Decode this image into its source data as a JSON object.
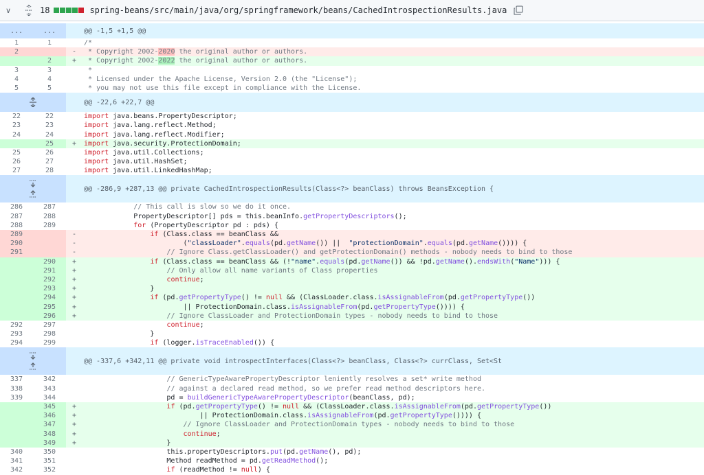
{
  "header": {
    "changes_count": "18",
    "file_path": "spring-beans/src/main/java/org/springframework/beans/CachedIntrospectionResults.java",
    "diffstat": [
      "#2da44e",
      "#2da44e",
      "#2da44e",
      "#2da44e",
      "#cf222e"
    ]
  },
  "hunks": [
    {
      "header": "@@ -1,5 +1,5 @@",
      "expander": "dots"
    },
    {
      "header": "@@ -22,6 +22,7 @@",
      "expander": "both"
    },
    {
      "header": "@@ -286,9 +287,13 @@ private CachedIntrospectionResults(Class<?> beanClass) throws BeansException {",
      "expander": "updown"
    },
    {
      "header": "@@ -337,6 +342,11 @@ private void introspectInterfaces(Class<?> beanClass, Class<?> currClass, Set<St",
      "expander": "updown"
    }
  ],
  "hunk1_left_dots": "...",
  "hunk1_right_dots": "...",
  "lines": {
    "h1": [
      {
        "o": "1",
        "n": "1",
        "t": "ctx",
        "c": "/*"
      },
      {
        "o": "2",
        "n": "",
        "t": "del",
        "c": " * Copyright 2002-2020 the original author or authors."
      },
      {
        "o": "",
        "n": "2",
        "t": "add",
        "c": " * Copyright 2002-2022 the original author or authors."
      },
      {
        "o": "3",
        "n": "3",
        "t": "ctx",
        "c": " *"
      },
      {
        "o": "4",
        "n": "4",
        "t": "ctx",
        "c": " * Licensed under the Apache License, Version 2.0 (the \"License\");"
      },
      {
        "o": "5",
        "n": "5",
        "t": "ctx",
        "c": " * you may not use this file except in compliance with the License."
      }
    ],
    "h2": [
      {
        "o": "22",
        "n": "22",
        "t": "ctx",
        "c": "import java.beans.PropertyDescriptor;"
      },
      {
        "o": "23",
        "n": "23",
        "t": "ctx",
        "c": "import java.lang.reflect.Method;"
      },
      {
        "o": "24",
        "n": "24",
        "t": "ctx",
        "c": "import java.lang.reflect.Modifier;"
      },
      {
        "o": "",
        "n": "25",
        "t": "add",
        "c": "import java.security.ProtectionDomain;"
      },
      {
        "o": "25",
        "n": "26",
        "t": "ctx",
        "c": "import java.util.Collections;"
      },
      {
        "o": "26",
        "n": "27",
        "t": "ctx",
        "c": "import java.util.HashSet;"
      },
      {
        "o": "27",
        "n": "28",
        "t": "ctx",
        "c": "import java.util.LinkedHashMap;"
      }
    ],
    "h3": [
      {
        "o": "286",
        "n": "287",
        "t": "ctx",
        "c": "            // This call is slow so we do it once."
      },
      {
        "o": "287",
        "n": "288",
        "t": "ctx",
        "c": "            PropertyDescriptor[] pds = this.beanInfo.getPropertyDescriptors();"
      },
      {
        "o": "288",
        "n": "289",
        "t": "ctx",
        "c": "            for (PropertyDescriptor pd : pds) {"
      },
      {
        "o": "289",
        "n": "",
        "t": "del",
        "c": "                if (Class.class == beanClass &&"
      },
      {
        "o": "290",
        "n": "",
        "t": "del",
        "c": "                        (\"classLoader\".equals(pd.getName()) ||  \"protectionDomain\".equals(pd.getName()))) {"
      },
      {
        "o": "291",
        "n": "",
        "t": "del",
        "c": "                    // Ignore Class.getClassLoader() and getProtectionDomain() methods - nobody needs to bind to those"
      },
      {
        "o": "",
        "n": "290",
        "t": "add",
        "c": "                if (Class.class == beanClass && (!\"name\".equals(pd.getName()) && !pd.getName().endsWith(\"Name\"))) {"
      },
      {
        "o": "",
        "n": "291",
        "t": "add",
        "c": "                    // Only allow all name variants of Class properties"
      },
      {
        "o": "",
        "n": "292",
        "t": "add",
        "c": "                    continue;"
      },
      {
        "o": "",
        "n": "293",
        "t": "add",
        "c": "                }"
      },
      {
        "o": "",
        "n": "294",
        "t": "add",
        "c": "                if (pd.getPropertyType() != null && (ClassLoader.class.isAssignableFrom(pd.getPropertyType())"
      },
      {
        "o": "",
        "n": "295",
        "t": "add",
        "c": "                        || ProtectionDomain.class.isAssignableFrom(pd.getPropertyType()))) {"
      },
      {
        "o": "",
        "n": "296",
        "t": "add",
        "c": "                    // Ignore ClassLoader and ProtectionDomain types - nobody needs to bind to those"
      },
      {
        "o": "292",
        "n": "297",
        "t": "ctx",
        "c": "                    continue;"
      },
      {
        "o": "293",
        "n": "298",
        "t": "ctx",
        "c": "                }"
      },
      {
        "o": "294",
        "n": "299",
        "t": "ctx",
        "c": "                if (logger.isTraceEnabled()) {"
      }
    ],
    "h4": [
      {
        "o": "337",
        "n": "342",
        "t": "ctx",
        "c": "                    // GenericTypeAwarePropertyDescriptor leniently resolves a set* write method"
      },
      {
        "o": "338",
        "n": "343",
        "t": "ctx",
        "c": "                    // against a declared read method, so we prefer read method descriptors here."
      },
      {
        "o": "339",
        "n": "344",
        "t": "ctx",
        "c": "                    pd = buildGenericTypeAwarePropertyDescriptor(beanClass, pd);"
      },
      {
        "o": "",
        "n": "345",
        "t": "add",
        "c": "                    if (pd.getPropertyType() != null && (ClassLoader.class.isAssignableFrom(pd.getPropertyType())"
      },
      {
        "o": "",
        "n": "346",
        "t": "add",
        "c": "                            || ProtectionDomain.class.isAssignableFrom(pd.getPropertyType()))) {"
      },
      {
        "o": "",
        "n": "347",
        "t": "add",
        "c": "                        // Ignore ClassLoader and ProtectionDomain types - nobody needs to bind to those"
      },
      {
        "o": "",
        "n": "348",
        "t": "add",
        "c": "                        continue;"
      },
      {
        "o": "",
        "n": "349",
        "t": "add",
        "c": "                    }"
      },
      {
        "o": "340",
        "n": "350",
        "t": "ctx",
        "c": "                    this.propertyDescriptors.put(pd.getName(), pd);"
      },
      {
        "o": "341",
        "n": "351",
        "t": "ctx",
        "c": "                    Method readMethod = pd.getReadMethod();"
      },
      {
        "o": "342",
        "n": "352",
        "t": "ctx",
        "c": "                    if (readMethod != null) {"
      }
    ]
  }
}
